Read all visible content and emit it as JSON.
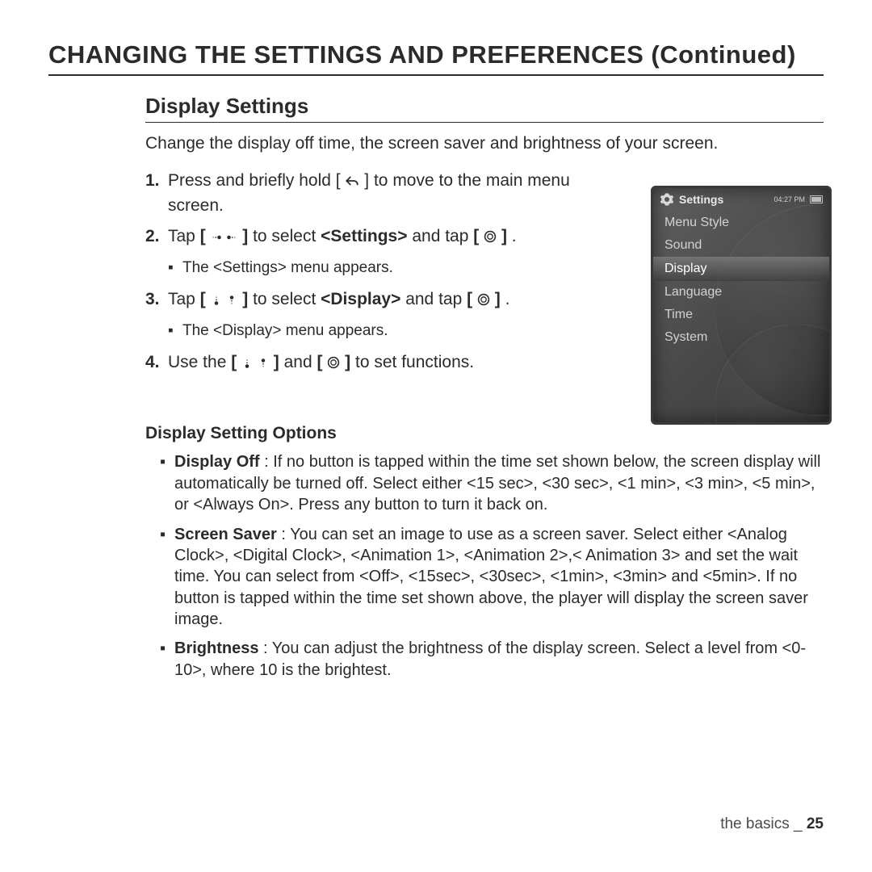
{
  "heading_main": "CHANGING THE SETTINGS AND PREFERENCES (Continued)",
  "heading_section": "Display Settings",
  "intro": "Change the display off time, the screen saver and brightness of your screen.",
  "steps": {
    "s1_num": "1.",
    "s1_a": "Press and briefly hold [",
    "s1_b": "] to move to the main menu screen.",
    "s2_num": "2.",
    "s2_a": "Tap ",
    "s2_b_bold": "[",
    "s2_c_bold": "]",
    "s2_d": " to select ",
    "s2_e_bold": "<Settings>",
    "s2_f": " and tap ",
    "s2_g_bold": "[",
    "s2_h_bold": "]",
    "s2_i": ".",
    "s2_sub": "The <Settings> menu appears.",
    "s3_num": "3.",
    "s3_a": "Tap ",
    "s3_b_bold": "[",
    "s3_c_bold": "]",
    "s3_d": " to select ",
    "s3_e_bold": "<Display>",
    "s3_f": " and tap ",
    "s3_g_bold": "[",
    "s3_h_bold": "]",
    "s3_i": ".",
    "s3_sub": "The <Display> menu appears.",
    "s4_num": "4.",
    "s4_a": "Use the ",
    "s4_b_bold": "[",
    "s4_c_bold": "]",
    "s4_d": " and ",
    "s4_e_bold": "[",
    "s4_f_bold": "]",
    "s4_g": " to set functions."
  },
  "device": {
    "title": "Settings",
    "clock": "04:27 PM",
    "menu": [
      "Menu Style",
      "Sound",
      "Display",
      "Language",
      "Time",
      "System"
    ],
    "selected_index": 2
  },
  "heading_options": "Display Setting Options",
  "options": {
    "o1_lead": "Display Off",
    "o1_body": " : If no button is tapped within the time set shown below, the screen display will automatically be turned off. Select either <15 sec>, <30 sec>, <1 min>, <3 min>, <5 min>, or <Always On>. Press any button to turn it back on.",
    "o2_lead": "Screen Saver",
    "o2_body": " : You can set an image to use as a screen saver. Select either <Analog Clock>, <Digital Clock>, <Animation 1>, <Animation 2>,< Animation 3> and set the wait time. You can select from <Off>, <15sec>, <30sec>, <1min>, <3min> and <5min>. If no button is tapped within the time set shown above, the player will display the screen saver image.",
    "o3_lead": "Brightness",
    "o3_body": " : You can adjust the brightness of the display screen. Select a level from <0-10>, where 10 is the brightest."
  },
  "footer": {
    "section": "the basics _ ",
    "page": "25"
  }
}
